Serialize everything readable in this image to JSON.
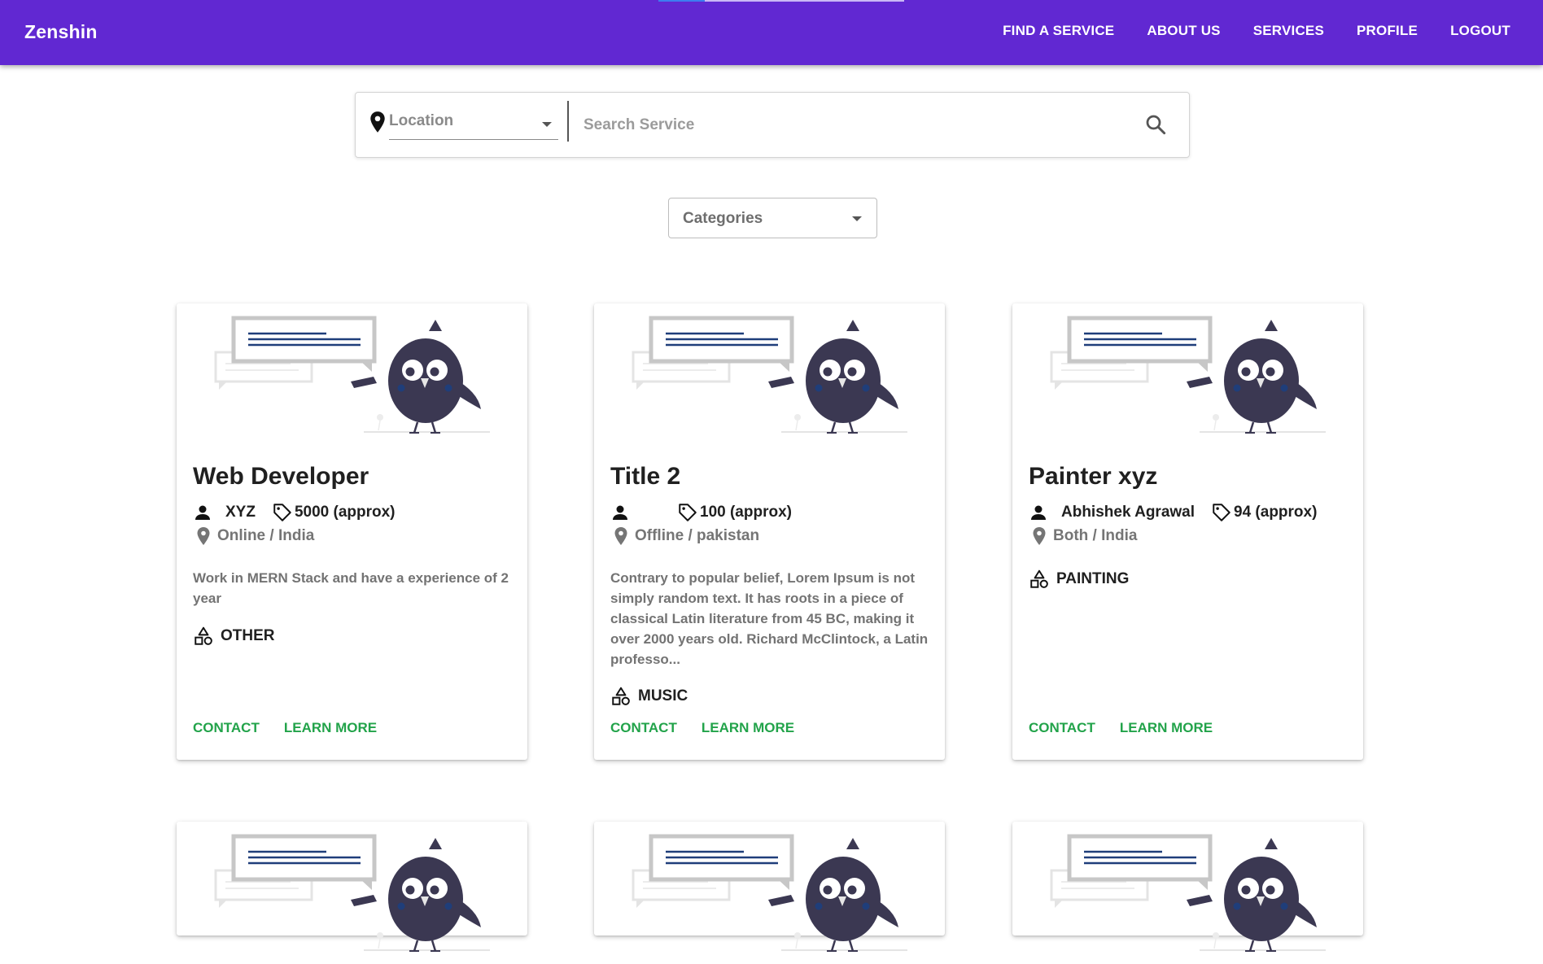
{
  "app": {
    "brand": "Zenshin"
  },
  "nav": {
    "items": [
      "FIND A SERVICE",
      "ABOUT US",
      "SERVICES",
      "PROFILE",
      "LOGOUT"
    ]
  },
  "progress": {
    "value": 0.19
  },
  "search": {
    "location_placeholder": "Location",
    "service_placeholder": "Search Service"
  },
  "filters": {
    "categories_label": "Categories"
  },
  "cards": [
    {
      "title": "Web Developer",
      "owner": "XYZ",
      "price": "5000 (approx)",
      "location": "Online / India",
      "description": "Work in MERN Stack and have a experience of 2 year",
      "category": "OTHER",
      "contact_label": "CONTACT",
      "learn_more_label": "LEARN MORE"
    },
    {
      "title": "Title 2",
      "owner": "",
      "price": "100 (approx)",
      "location": "Offline / pakistan",
      "description": "Contrary to popular belief, Lorem Ipsum is not simply random text. It has roots in a piece of classical Latin literature from 45 BC, making it over 2000 years old. Richard McClintock, a Latin professo...",
      "category": "MUSIC",
      "contact_label": "CONTACT",
      "learn_more_label": "LEARN MORE"
    },
    {
      "title": "Painter xyz",
      "owner": "Abhishek Agrawal",
      "price": "94 (approx)",
      "location": "Both / India",
      "description": "",
      "category": "PAINTING",
      "contact_label": "CONTACT",
      "learn_more_label": "LEARN MORE"
    }
  ],
  "colors": {
    "header_bg": "#6128d2",
    "action_text": "#22a34a",
    "illustration_bird": "#3b3852",
    "illustration_lines": "#1f3e7a"
  },
  "icons": [
    "map-pin-icon",
    "search-icon",
    "person-icon",
    "price-tag-icon",
    "location-pin-icon",
    "category-shapes-icon"
  ]
}
